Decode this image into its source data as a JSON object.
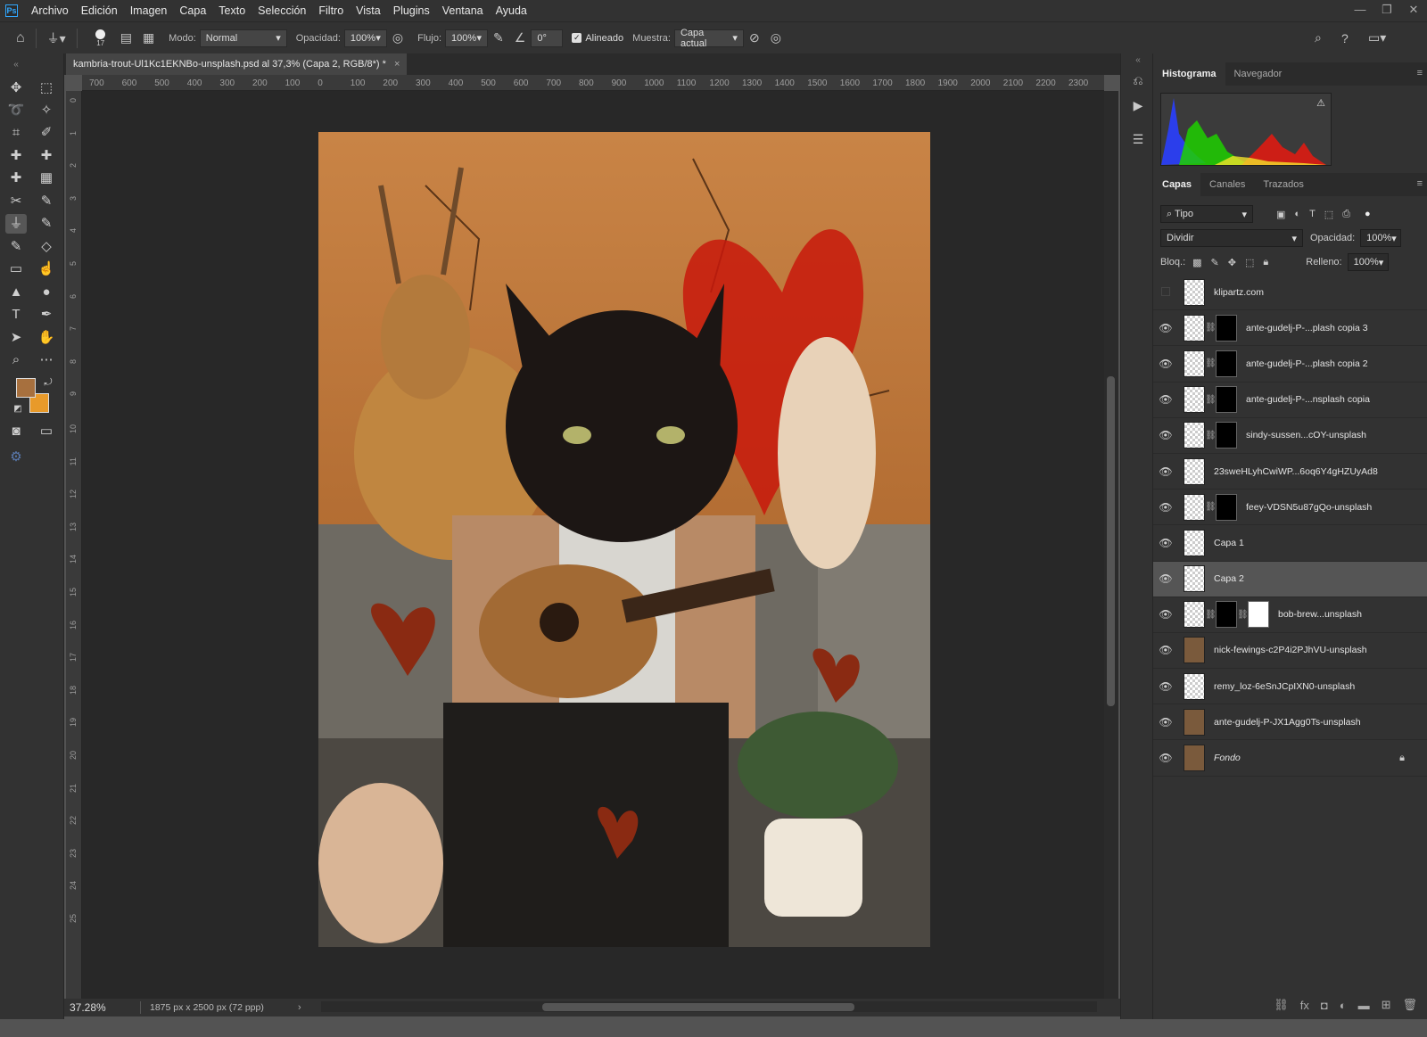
{
  "app": {
    "logo": "Ps"
  },
  "menu": [
    "Archivo",
    "Edición",
    "Imagen",
    "Capa",
    "Texto",
    "Selección",
    "Filtro",
    "Vista",
    "Plugins",
    "Ventana",
    "Ayuda"
  ],
  "window_controls": {
    "minimize": "—",
    "restore": "❐",
    "close": "✕"
  },
  "options": {
    "brush_size": "17",
    "mode_label": "Modo:",
    "mode_value": "Normal",
    "opacity_label": "Opacidad:",
    "opacity_value": "100%",
    "flow_label": "Flujo:",
    "flow_value": "100%",
    "angle_value": "0°",
    "aligned_label": "Alineado",
    "sample_label": "Muestra:",
    "sample_value": "Capa actual"
  },
  "document": {
    "tab_title": "kambria-trout-Ul1Kc1EKNBo-unsplash.psd al 37,3% (Capa 2, RGB/8*) *",
    "tab_close": "×"
  },
  "ruler": {
    "top": [
      "700",
      "600",
      "500",
      "400",
      "300",
      "200",
      "100",
      "0",
      "100",
      "200",
      "300",
      "400",
      "500",
      "600",
      "700",
      "800",
      "900",
      "1000",
      "1100",
      "1200",
      "1300",
      "1400",
      "1500",
      "1600",
      "1700",
      "1800",
      "1900",
      "2000",
      "2100",
      "2200",
      "2300"
    ],
    "left": [
      "0",
      "1",
      "2",
      "3",
      "4",
      "5",
      "6",
      "7",
      "8",
      "9",
      "10",
      "11",
      "12",
      "13",
      "14",
      "15",
      "16",
      "17",
      "18",
      "19",
      "20",
      "21",
      "22",
      "23",
      "24",
      "25"
    ]
  },
  "status": {
    "zoom": "37.28%",
    "dims": "1875 px x 2500 px (72 ppp)"
  },
  "panels": {
    "top_tabs": [
      "Histograma",
      "Navegador"
    ],
    "layer_tabs": [
      "Capas",
      "Canales",
      "Trazados"
    ],
    "filter_value": "Tipo",
    "blend_value": "Dividir",
    "opacity_label": "Opacidad:",
    "opacity_value": "100%",
    "lock_label": "Bloq.:",
    "fill_label": "Relleno:",
    "fill_value": "100%"
  },
  "layers": [
    {
      "name": "klipartz.com",
      "visible": false,
      "masks": 0,
      "selected": false,
      "locked": false
    },
    {
      "name": "ante-gudelj-P-...plash copia 3",
      "visible": true,
      "masks": 1,
      "selected": false,
      "locked": false
    },
    {
      "name": "ante-gudelj-P-...plash copia 2",
      "visible": true,
      "masks": 1,
      "selected": false,
      "locked": false
    },
    {
      "name": "ante-gudelj-P-...nsplash copia",
      "visible": true,
      "masks": 1,
      "selected": false,
      "locked": false
    },
    {
      "name": "sindy-sussen...cOY-unsplash",
      "visible": true,
      "masks": 1,
      "selected": false,
      "locked": false
    },
    {
      "name": "23sweHLyhCwiWP...6oq6Y4gHZUyAd8",
      "visible": true,
      "masks": 0,
      "selected": false,
      "locked": false
    },
    {
      "name": "feey-VDSN5u87gQo-unsplash",
      "visible": true,
      "masks": 1,
      "selected": false,
      "locked": false
    },
    {
      "name": "Capa 1",
      "visible": true,
      "masks": 0,
      "selected": false,
      "locked": false
    },
    {
      "name": "Capa 2",
      "visible": true,
      "masks": 0,
      "selected": true,
      "locked": false
    },
    {
      "name": "bob-brew...unsplash",
      "visible": true,
      "masks": 2,
      "selected": false,
      "locked": false
    },
    {
      "name": "nick-fewings-c2P4i2PJhVU-unsplash",
      "visible": true,
      "masks": 0,
      "selected": false,
      "locked": false
    },
    {
      "name": "remy_loz-6eSnJCpIXN0-unsplash",
      "visible": true,
      "masks": 0,
      "selected": false,
      "locked": false
    },
    {
      "name": "ante-gudelj-P-JX1Agg0Ts-unsplash",
      "visible": true,
      "masks": 0,
      "selected": false,
      "locked": false
    },
    {
      "name": "Fondo",
      "visible": true,
      "masks": 0,
      "selected": false,
      "locked": true
    }
  ],
  "colors": {
    "foreground": "#a7703e",
    "background": "#e89a2a",
    "accent": "#31a8ff"
  }
}
